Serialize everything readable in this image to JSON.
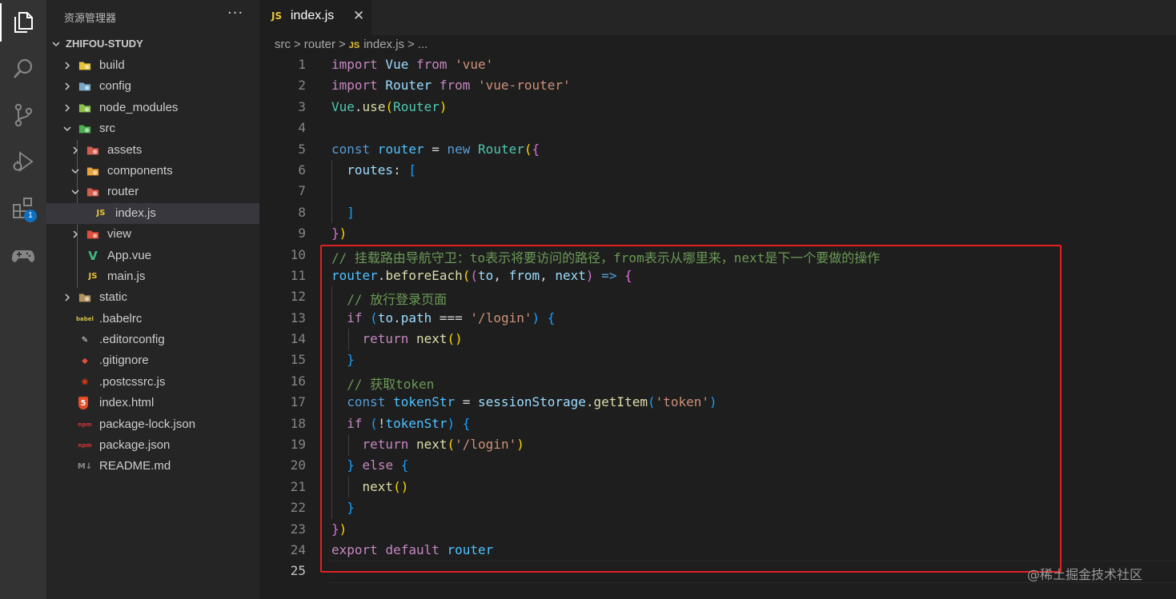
{
  "activity_bar": {
    "items": [
      {
        "icon": "explorer-icon",
        "active": true
      },
      {
        "icon": "search-icon"
      },
      {
        "icon": "source-control-icon"
      },
      {
        "icon": "run-debug-icon"
      },
      {
        "icon": "extensions-icon",
        "badge": "1"
      },
      {
        "icon": "remote-gamepad-icon"
      }
    ]
  },
  "sidebar": {
    "title": "资源管理器",
    "more": "···",
    "root": "ZHIFOU-STUDY",
    "tree": [
      {
        "name": "build",
        "depth": 0,
        "chevron": "right",
        "icon": "folder-build-icon",
        "iconColor": "#e8c43a"
      },
      {
        "name": "config",
        "depth": 0,
        "chevron": "right",
        "icon": "folder-config-icon",
        "iconColor": "#7aa7c7"
      },
      {
        "name": "node_modules",
        "depth": 0,
        "chevron": "right",
        "icon": "folder-node-icon",
        "iconColor": "#8bc34a"
      },
      {
        "name": "src",
        "depth": 0,
        "chevron": "down",
        "icon": "folder-src-icon",
        "iconColor": "#4caf50"
      },
      {
        "name": "assets",
        "depth": 1,
        "chevron": "right",
        "icon": "folder-assets-icon",
        "iconColor": "#d65d4e"
      },
      {
        "name": "components",
        "depth": 1,
        "chevron": "down",
        "icon": "folder-components-icon",
        "iconColor": "#e8a33a"
      },
      {
        "name": "router",
        "depth": 1,
        "chevron": "down",
        "icon": "folder-router-icon",
        "iconColor": "#d65d4e"
      },
      {
        "name": "index.js",
        "depth": 2,
        "chevron": "",
        "icon": "js-file-icon",
        "iconText": "JS",
        "iconColor": "#e8c43a",
        "selected": true
      },
      {
        "name": "view",
        "depth": 1,
        "chevron": "right",
        "icon": "folder-view-icon",
        "iconColor": "#e04e39"
      },
      {
        "name": "App.vue",
        "depth": 1,
        "chevron": "",
        "icon": "vue-file-icon",
        "iconText": "V",
        "iconColor": "#41b883"
      },
      {
        "name": "main.js",
        "depth": 1,
        "chevron": "",
        "icon": "js-file-icon",
        "iconText": "JS",
        "iconColor": "#e8c43a"
      },
      {
        "name": "static",
        "depth": 0,
        "chevron": "right",
        "icon": "folder-static-icon",
        "iconColor": "#b59361"
      },
      {
        "name": ".babelrc",
        "depth": 0,
        "chevron": "",
        "icon": "babel-file-icon",
        "iconText": "babel",
        "iconColor": "#d7c04c"
      },
      {
        "name": ".editorconfig",
        "depth": 0,
        "chevron": "",
        "icon": "editorconfig-file-icon",
        "iconText": "✎",
        "iconColor": "#e0e0e0"
      },
      {
        "name": ".gitignore",
        "depth": 0,
        "chevron": "",
        "icon": "git-file-icon",
        "iconText": "◆",
        "iconColor": "#e04e39"
      },
      {
        "name": ".postcssrc.js",
        "depth": 0,
        "chevron": "",
        "icon": "postcss-file-icon",
        "iconText": "◉",
        "iconColor": "#dd3a0a"
      },
      {
        "name": "index.html",
        "depth": 0,
        "chevron": "",
        "icon": "html-file-icon",
        "iconText": "5",
        "iconColor": "#e44d26"
      },
      {
        "name": "package-lock.json",
        "depth": 0,
        "chevron": "",
        "icon": "npm-file-icon",
        "iconText": "npm",
        "iconColor": "#cb3837"
      },
      {
        "name": "package.json",
        "depth": 0,
        "chevron": "",
        "icon": "npm-file-icon",
        "iconText": "npm",
        "iconColor": "#cb3837"
      },
      {
        "name": "README.md",
        "depth": 0,
        "chevron": "",
        "icon": "markdown-file-icon",
        "iconText": "M↓",
        "iconColor": "#8a8a8a"
      }
    ]
  },
  "editor": {
    "tab": {
      "badge": "JS",
      "label": "index.js",
      "close": "✕"
    },
    "breadcrumbs": {
      "parts": [
        "src",
        "router",
        "index.js",
        "..."
      ],
      "sep": ">",
      "fileBadge": "JS"
    },
    "current_line": 25,
    "lines": [
      [
        [
          "import",
          "#c586c0"
        ],
        [
          " Vue ",
          "#9cdcfe"
        ],
        [
          "from",
          "#c586c0"
        ],
        [
          " ",
          "#d4d4d4"
        ],
        [
          "'vue'",
          "#ce9178"
        ]
      ],
      [
        [
          "import",
          "#c586c0"
        ],
        [
          " Router ",
          "#9cdcfe"
        ],
        [
          "from",
          "#c586c0"
        ],
        [
          " ",
          "#d4d4d4"
        ],
        [
          "'vue-router'",
          "#ce9178"
        ]
      ],
      [
        [
          "Vue",
          "#4ec9b0"
        ],
        [
          ".",
          "#d4d4d4"
        ],
        [
          "use",
          "#dcdcaa"
        ],
        [
          "(",
          "#ffd700"
        ],
        [
          "Router",
          "#4ec9b0"
        ],
        [
          ")",
          "#ffd700"
        ]
      ],
      [],
      [
        [
          "const",
          "#569cd6"
        ],
        [
          " router ",
          "#4fc1ff"
        ],
        [
          "= ",
          "#d4d4d4"
        ],
        [
          "new",
          "#569cd6"
        ],
        [
          " ",
          "#d4d4d4"
        ],
        [
          "Router",
          "#4ec9b0"
        ],
        [
          "(",
          "#ffd700"
        ],
        [
          "{",
          "#da70d6"
        ]
      ],
      [
        [
          "  routes",
          "#9cdcfe"
        ],
        [
          ": ",
          "#d4d4d4"
        ],
        [
          "[",
          "#179fff"
        ]
      ],
      [],
      [
        [
          "  ",
          "#d4d4d4"
        ],
        [
          "]",
          "#179fff"
        ]
      ],
      [
        [
          "}",
          "#da70d6"
        ],
        [
          ")",
          "#ffd700"
        ]
      ],
      [
        [
          "// 挂载路由导航守卫：to表示将要访问的路径，from表示从哪里来，next是下一个要做的操作",
          "#6a9955"
        ]
      ],
      [
        [
          "router",
          "#4fc1ff"
        ],
        [
          ".",
          "#d4d4d4"
        ],
        [
          "beforeEach",
          "#dcdcaa"
        ],
        [
          "(",
          "#ffd700"
        ],
        [
          "(",
          "#da70d6"
        ],
        [
          "to",
          "#9cdcfe"
        ],
        [
          ", ",
          "#d4d4d4"
        ],
        [
          "from",
          "#9cdcfe"
        ],
        [
          ", ",
          "#d4d4d4"
        ],
        [
          "next",
          "#9cdcfe"
        ],
        [
          ")",
          "#da70d6"
        ],
        [
          " => ",
          "#569cd6"
        ],
        [
          "{",
          "#da70d6"
        ]
      ],
      [
        [
          "  // 放行登录页面",
          "#6a9955"
        ]
      ],
      [
        [
          "  ",
          "#d4d4d4"
        ],
        [
          "if",
          "#c586c0"
        ],
        [
          " ",
          "#d4d4d4"
        ],
        [
          "(",
          "#179fff"
        ],
        [
          "to",
          "#9cdcfe"
        ],
        [
          ".",
          "#d4d4d4"
        ],
        [
          "path",
          "#9cdcfe"
        ],
        [
          " === ",
          "#d4d4d4"
        ],
        [
          "'/login'",
          "#ce9178"
        ],
        [
          ")",
          "#179fff"
        ],
        [
          " ",
          "#d4d4d4"
        ],
        [
          "{",
          "#179fff"
        ]
      ],
      [
        [
          "    ",
          "#d4d4d4"
        ],
        [
          "return",
          "#c586c0"
        ],
        [
          " ",
          "#d4d4d4"
        ],
        [
          "next",
          "#dcdcaa"
        ],
        [
          "()",
          "#ffd700"
        ]
      ],
      [
        [
          "  ",
          "#d4d4d4"
        ],
        [
          "}",
          "#179fff"
        ]
      ],
      [
        [
          "  // 获取token",
          "#6a9955"
        ]
      ],
      [
        [
          "  ",
          "#d4d4d4"
        ],
        [
          "const",
          "#569cd6"
        ],
        [
          " tokenStr ",
          "#4fc1ff"
        ],
        [
          "= ",
          "#d4d4d4"
        ],
        [
          "sessionStorage",
          "#9cdcfe"
        ],
        [
          ".",
          "#d4d4d4"
        ],
        [
          "getItem",
          "#dcdcaa"
        ],
        [
          "(",
          "#179fff"
        ],
        [
          "'token'",
          "#ce9178"
        ],
        [
          ")",
          "#179fff"
        ]
      ],
      [
        [
          "  ",
          "#d4d4d4"
        ],
        [
          "if",
          "#c586c0"
        ],
        [
          " ",
          "#d4d4d4"
        ],
        [
          "(",
          "#179fff"
        ],
        [
          "!",
          "#d4d4d4"
        ],
        [
          "tokenStr",
          "#4fc1ff"
        ],
        [
          ")",
          "#179fff"
        ],
        [
          " ",
          "#d4d4d4"
        ],
        [
          "{",
          "#179fff"
        ]
      ],
      [
        [
          "    ",
          "#d4d4d4"
        ],
        [
          "return",
          "#c586c0"
        ],
        [
          " ",
          "#d4d4d4"
        ],
        [
          "next",
          "#dcdcaa"
        ],
        [
          "(",
          "#ffd700"
        ],
        [
          "'/login'",
          "#ce9178"
        ],
        [
          ")",
          "#ffd700"
        ]
      ],
      [
        [
          "  ",
          "#d4d4d4"
        ],
        [
          "}",
          "#179fff"
        ],
        [
          " ",
          "#d4d4d4"
        ],
        [
          "else",
          "#c586c0"
        ],
        [
          " ",
          "#d4d4d4"
        ],
        [
          "{",
          "#179fff"
        ]
      ],
      [
        [
          "    ",
          "#d4d4d4"
        ],
        [
          "next",
          "#dcdcaa"
        ],
        [
          "()",
          "#ffd700"
        ]
      ],
      [
        [
          "  ",
          "#d4d4d4"
        ],
        [
          "}",
          "#179fff"
        ]
      ],
      [
        [
          "}",
          "#da70d6"
        ],
        [
          ")",
          "#ffd700"
        ]
      ],
      [
        [
          "export",
          "#c586c0"
        ],
        [
          " ",
          "#d4d4d4"
        ],
        [
          "default",
          "#c586c0"
        ],
        [
          " router",
          "#4fc1ff"
        ]
      ],
      []
    ]
  },
  "watermark": "@稀土掘金技术社区"
}
